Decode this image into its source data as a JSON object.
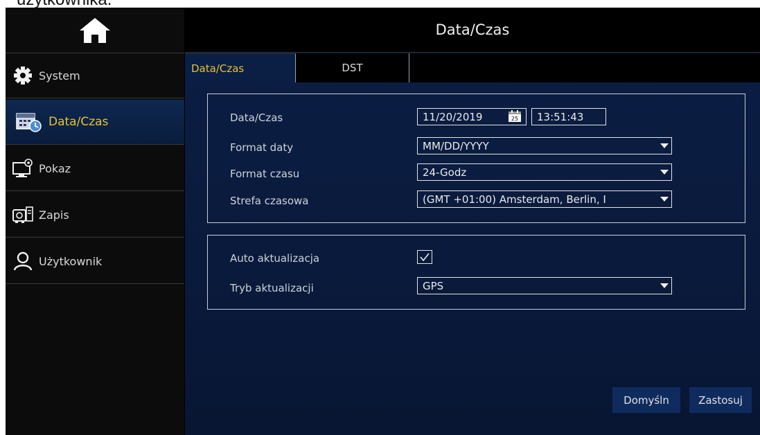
{
  "caption": "użytkownika.",
  "header": {
    "title": "Data/Czas"
  },
  "sidebar": {
    "home_icon": "home-icon",
    "items": [
      {
        "label": "System",
        "icon": "gear-icon"
      },
      {
        "label": "Data/Czas",
        "icon": "calendar-clock-icon",
        "active": true
      },
      {
        "label": "Pokaz",
        "icon": "monitor-settings-icon"
      },
      {
        "label": "Zapis",
        "icon": "record-camera-icon"
      },
      {
        "label": "Użytkownik",
        "icon": "user-icon"
      }
    ]
  },
  "tabs": [
    {
      "label": "Data/Czas",
      "active": true
    },
    {
      "label": "DST",
      "active": false
    }
  ],
  "form": {
    "datetime_label": "Data/Czas",
    "date_value": "11/20/2019",
    "calendar_day": "25",
    "time_value": "13:51:43",
    "date_format_label": "Format daty",
    "date_format_value": "MM/DD/YYYY",
    "time_format_label": "Format czasu",
    "time_format_value": "24-Godz",
    "timezone_label": "Strefa czasowa",
    "timezone_value": "(GMT +01:00) Amsterdam, Berlin, I",
    "auto_update_label": "Auto aktualizacja",
    "auto_update_checked": true,
    "update_mode_label": "Tryb aktualizacji",
    "update_mode_value": "GPS"
  },
  "buttons": {
    "default_label": "Domyśln",
    "apply_label": "Zastosuj"
  },
  "colors": {
    "accent": "#e8c235",
    "panel": "#0b1e44",
    "button": "#0f2b5e"
  }
}
